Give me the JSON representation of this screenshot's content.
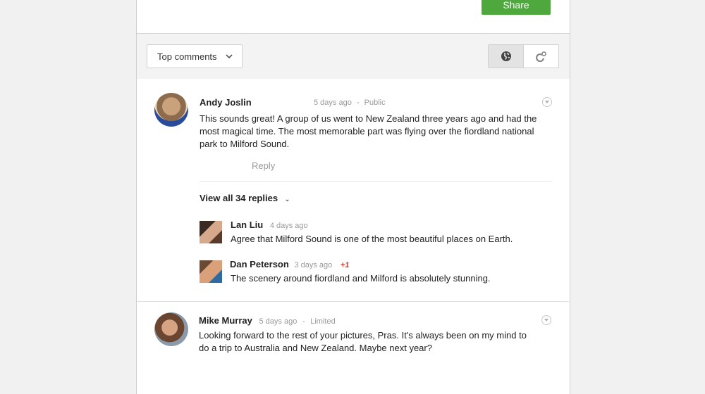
{
  "header": {
    "share_label": "Share"
  },
  "toolbar": {
    "sort_selected": "Top comments",
    "visibility_buttons": [
      {
        "icon": "globe-icon",
        "active": true
      },
      {
        "icon": "circles-icon",
        "active": false
      }
    ]
  },
  "comments": [
    {
      "author": "Andy Joslin",
      "time": "5 days ago",
      "separator": "-",
      "visibility": "Public",
      "text": "This sounds great! A group of us went to New Zealand three years ago and had the most magical time. The most memorable part was flying over the fiordland national park to Milford Sound.",
      "reply_label": "Reply",
      "view_all_label": "View all 34 replies",
      "replies": [
        {
          "author": "Lan Liu",
          "time": "4 days ago",
          "plus": "",
          "text": "Agree that Milford Sound is one of the most beautiful places on Earth."
        },
        {
          "author": "Dan Peterson",
          "time": "3 days ago",
          "plus": "+1",
          "text": "The scenery around fiordland and Milford is absolutely stunning."
        }
      ]
    },
    {
      "author": "Mike Murray",
      "time": "5 days ago",
      "separator": "-",
      "visibility": "Limited",
      "text": "Looking forward to the rest of your pictures, Pras. It's always been on my mind to do a trip to Australia and New Zealand. Maybe next year?"
    }
  ],
  "colors": {
    "share_green": "#4fa83d",
    "plus_one_red": "#d23f31"
  }
}
